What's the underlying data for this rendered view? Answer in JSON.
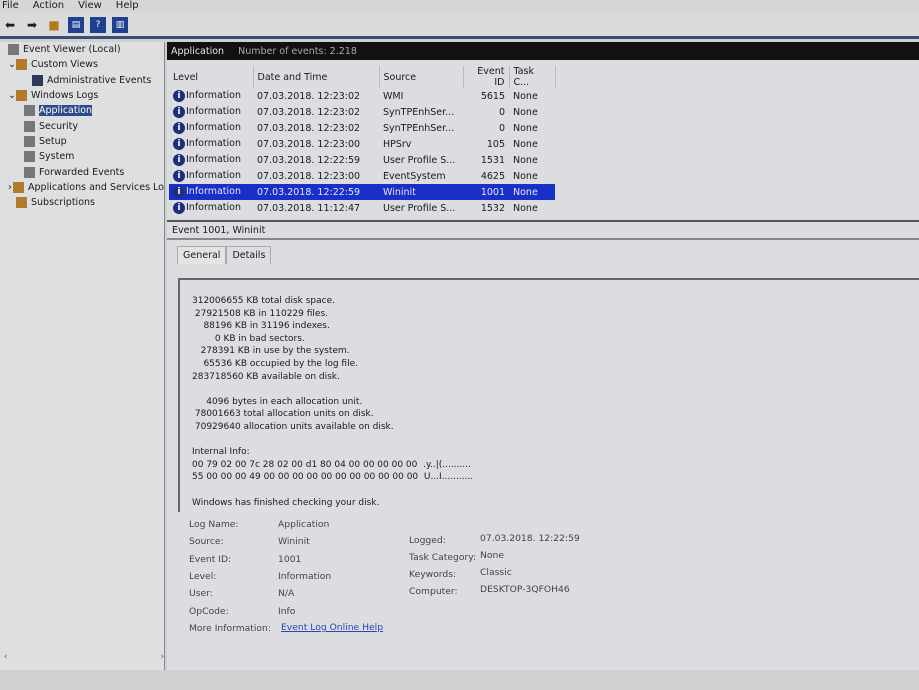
{
  "menu": [
    "File",
    "Action",
    "View",
    "Help"
  ],
  "tree": [
    {
      "label": "Event Viewer (Local)",
      "indent": 0
    },
    {
      "label": "Custom Views",
      "indent": 1,
      "arrow": "v"
    },
    {
      "label": "Administrative Events",
      "indent": 3
    },
    {
      "label": "Windows Logs",
      "indent": 1,
      "arrow": "v"
    },
    {
      "label": "Application",
      "indent": 2,
      "selected": true
    },
    {
      "label": "Security",
      "indent": 2
    },
    {
      "label": "Setup",
      "indent": 2
    },
    {
      "label": "System",
      "indent": 2
    },
    {
      "label": "Forwarded Events",
      "indent": 2
    },
    {
      "label": "Applications and Services Lo",
      "indent": 1,
      "arrow": ">"
    },
    {
      "label": "Subscriptions",
      "indent": 1
    }
  ],
  "header": {
    "title": "Application",
    "count": "Number of events: 2.218"
  },
  "columns": [
    "Level",
    "Date and Time",
    "Source",
    "Event ID",
    "Task C..."
  ],
  "rows": [
    [
      "Information",
      "07.03.2018. 12:23:02",
      "WMI",
      "5615",
      "None"
    ],
    [
      "Information",
      "07.03.2018. 12:23:02",
      "SynTPEnhSer...",
      "0",
      "None"
    ],
    [
      "Information",
      "07.03.2018. 12:23:02",
      "SynTPEnhSer...",
      "0",
      "None"
    ],
    [
      "Information",
      "07.03.2018. 12:23:00",
      "HPSrv",
      "105",
      "None"
    ],
    [
      "Information",
      "07.03.2018. 12:22:59",
      "User Profile S...",
      "1531",
      "None"
    ],
    [
      "Information",
      "07.03.2018. 12:23:00",
      "EventSystem",
      "4625",
      "None"
    ],
    [
      "Information",
      "07.03.2018. 12:22:59",
      "Wininit",
      "1001",
      "None"
    ],
    [
      "Information",
      "07.03.2018. 11:12:47",
      "User Profile S...",
      "1532",
      "None"
    ]
  ],
  "selected_row": 6,
  "detail": {
    "title": "Event 1001, Wininit",
    "tabs": [
      "General",
      "Details"
    ],
    "message": "312006655 KB total disk space.\n 27921508 KB in 110229 files.\n    88196 KB in 31196 indexes.\n        0 KB in bad sectors.\n   278391 KB in use by the system.\n    65536 KB occupied by the log file.\n283718560 KB available on disk.\n\n     4096 bytes in each allocation unit.\n 78001663 total allocation units on disk.\n 70929640 allocation units available on disk.\n\nInternal Info:\n00 79 02 00 7c 28 02 00 d1 80 04 00 00 00 00 00  .y..|(..........\n55 00 00 00 49 00 00 00 00 00 00 00 00 00 00 00  U...I...........\n\nWindows has finished checking your disk.",
    "props_left": [
      [
        "Log Name:",
        "Application"
      ],
      [
        "Source:",
        "Wininit"
      ],
      [
        "Event ID:",
        "1001"
      ],
      [
        "Level:",
        "Information"
      ],
      [
        "User:",
        "N/A"
      ],
      [
        "OpCode:",
        "Info"
      ]
    ],
    "props_right": [
      [
        "Logged:",
        "07.03.2018. 12:22:59"
      ],
      [
        "Task Category:",
        "None"
      ],
      [
        "Keywords:",
        "Classic"
      ],
      [
        "Computer:",
        "DESKTOP-3QFOH46"
      ]
    ],
    "more_info_label": "More Information:",
    "more_info_link": "Event Log Online Help"
  }
}
